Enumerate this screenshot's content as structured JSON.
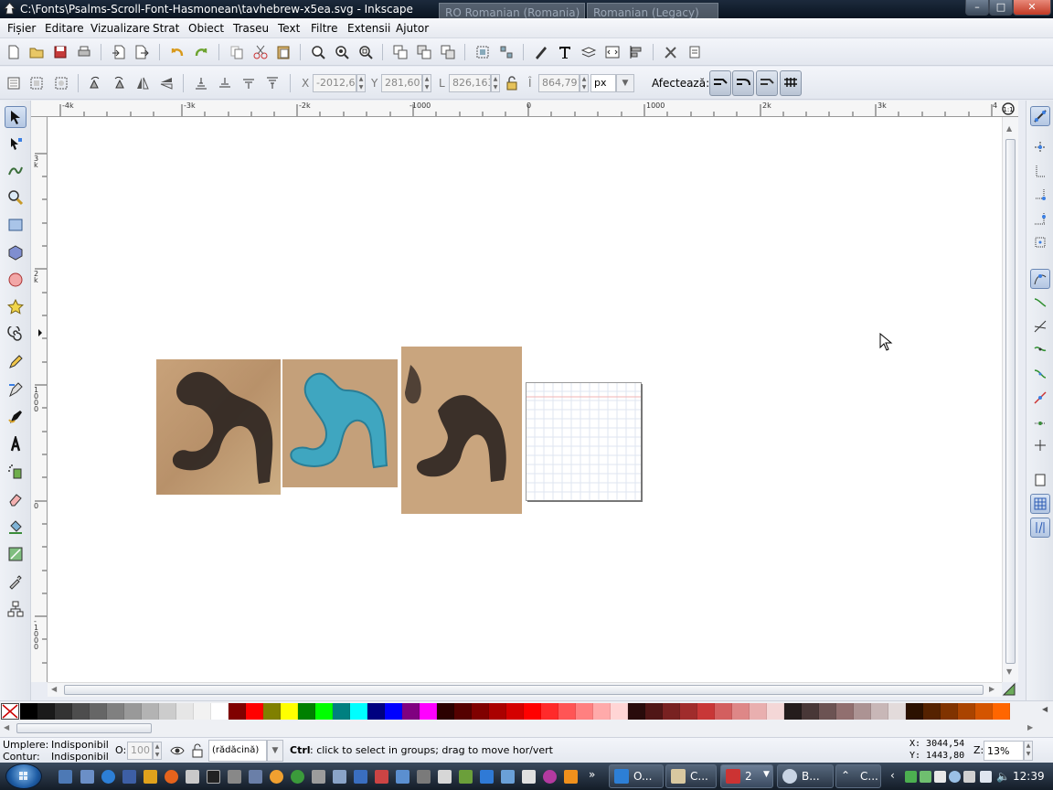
{
  "window": {
    "title": "C:\\Fonts\\Psalms-Scroll-Font-Hasmonean\\tavhebrew-x5ea.svg - Inkscape",
    "lang_indicator_1": "RO Romanian (Romania)",
    "lang_indicator_2": "Romanian (Legacy)",
    "minimize": "–",
    "maximize": "□",
    "close": "✕"
  },
  "menu": {
    "items": [
      "Fișier",
      "Editare",
      "Vizualizare",
      "Strat",
      "Obiect",
      "Traseu",
      "Text",
      "Filtre",
      "Extensii",
      "Ajutor"
    ]
  },
  "select_toolbar": {
    "x_label": "X",
    "x_value": "-2012,6(",
    "y_label": "Y",
    "y_value": "281,601",
    "w_label": "L",
    "w_value": "826,163",
    "h_label": "Î",
    "h_value": "864,791",
    "unit": "px",
    "affects_label": "Afectează:"
  },
  "rulers": {
    "top_labels": [
      "-4k",
      "-3k",
      "-2k",
      "-1000",
      "0",
      "1000",
      "2k",
      "3k",
      "4"
    ],
    "left_labels": [
      "3\nk",
      "2\nk",
      "1\n0\n0\n0",
      "0",
      "-\n1\n0\n0\n0"
    ]
  },
  "palette": {
    "colors": [
      "#000000",
      "#1a1a1a",
      "#333333",
      "#4d4d4d",
      "#666666",
      "#808080",
      "#999999",
      "#b3b3b3",
      "#cccccc",
      "#e6e6e6",
      "#f2f2f2",
      "#ffffff",
      "#800000",
      "#ff0000",
      "#808000",
      "#ffff00",
      "#008000",
      "#00ff00",
      "#008080",
      "#00ffff",
      "#000080",
      "#0000ff",
      "#800080",
      "#ff00ff",
      "#2b0000",
      "#550000",
      "#800000",
      "#aa0000",
      "#d40000",
      "#ff0000",
      "#ff2a2a",
      "#ff5555",
      "#ff8080",
      "#ffaaaa",
      "#ffd5d5",
      "#280b0b",
      "#501616",
      "#782121",
      "#a02c2c",
      "#c83737",
      "#d35f5f",
      "#de8787",
      "#e9afaf",
      "#f4d7d7",
      "#241c1c",
      "#483737",
      "#6c5353",
      "#916f6f",
      "#ac9393",
      "#c8b7b7",
      "#e3dbdb",
      "#2b1100",
      "#552200",
      "#803300",
      "#aa4400",
      "#d45500",
      "#ff6600"
    ]
  },
  "status": {
    "fill_label": "Umplere:",
    "fill_value": "Indisponibil",
    "stroke_label": "Contur:",
    "stroke_value": "Indisponibil",
    "opacity_label": "O:",
    "opacity_value": "100",
    "layer": "(rădăcină)",
    "message_key": "Ctrl",
    "message": ": click to select in groups; drag to move hor/vert",
    "cursor_x": "X: 3044,54",
    "cursor_y": "Y: 1443,80",
    "zoom_label": "Z:",
    "zoom_value": "13%"
  },
  "taskbar": {
    "buttons": [
      "O...",
      "C...",
      "2",
      "B...",
      "C..."
    ],
    "clock": "12:39"
  }
}
